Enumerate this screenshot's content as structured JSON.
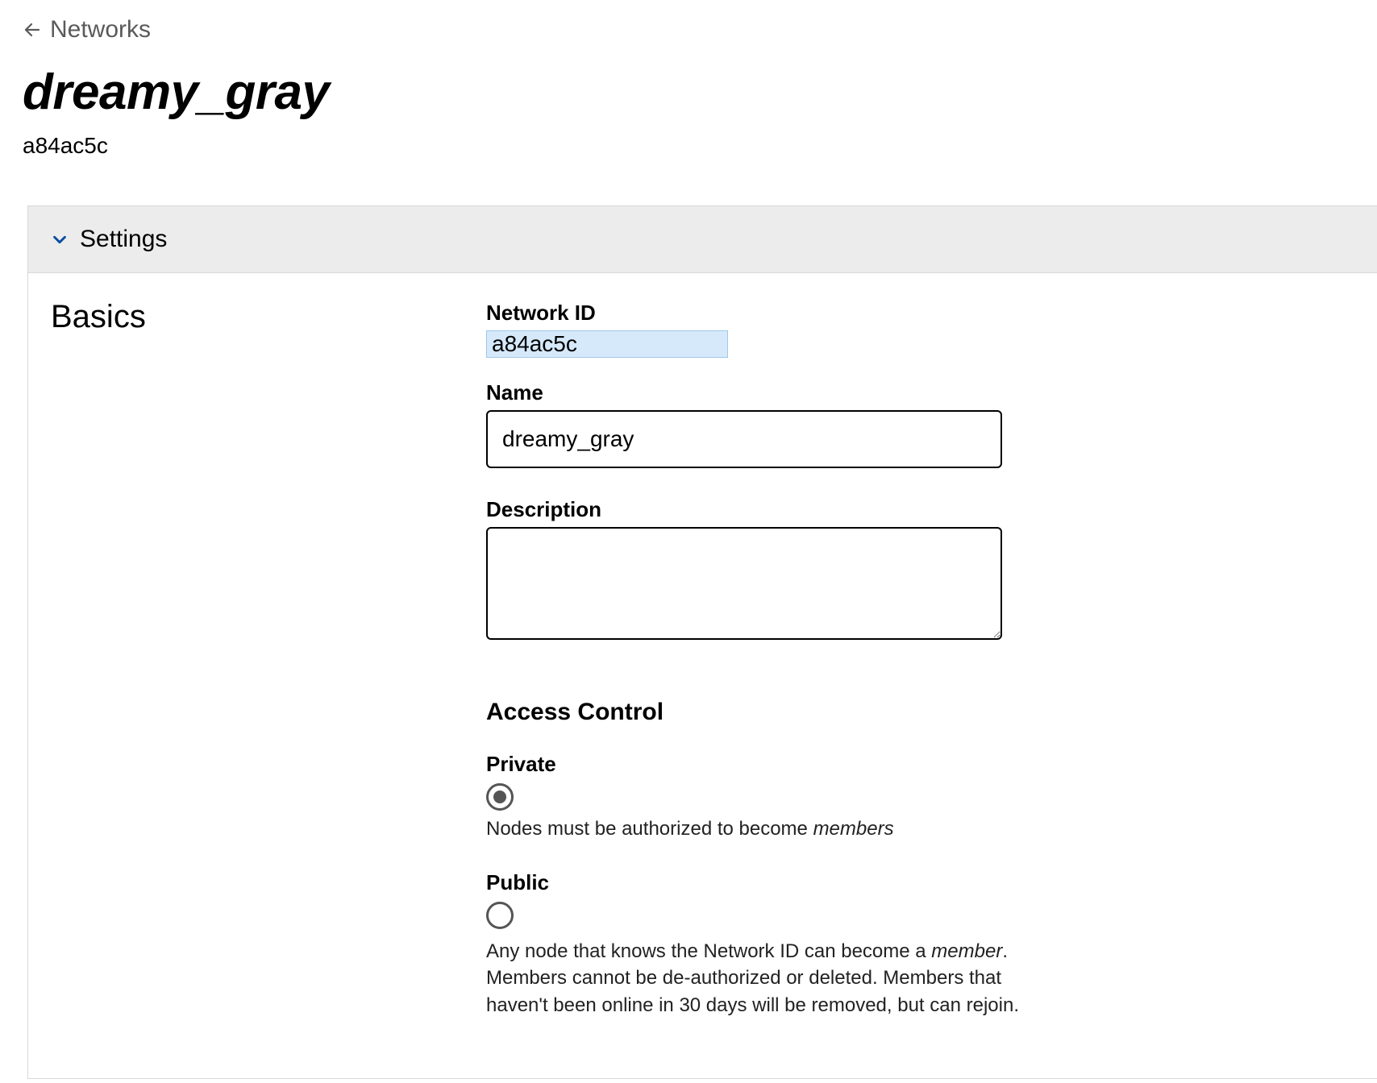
{
  "breadcrumb": {
    "back_label": "Networks"
  },
  "header": {
    "title": "dreamy_gray",
    "network_id_short": "a84ac5c"
  },
  "settings_panel": {
    "title": "Settings",
    "basics": {
      "heading": "Basics",
      "network_id_label": "Network ID",
      "network_id_value": "a84ac5c",
      "name_label": "Name",
      "name_value": "dreamy_gray",
      "description_label": "Description",
      "description_value": ""
    },
    "access_control": {
      "heading": "Access Control",
      "private": {
        "label": "Private",
        "selected": true,
        "help_pre": "Nodes must be authorized to become ",
        "help_em": "members"
      },
      "public": {
        "label": "Public",
        "selected": false,
        "help_pre": "Any node that knows the Network ID can become a ",
        "help_em": "member",
        "help_post": ". Members cannot be de-authorized or deleted. Members that haven't been online in 30 days will be removed, but can rejoin."
      }
    }
  }
}
